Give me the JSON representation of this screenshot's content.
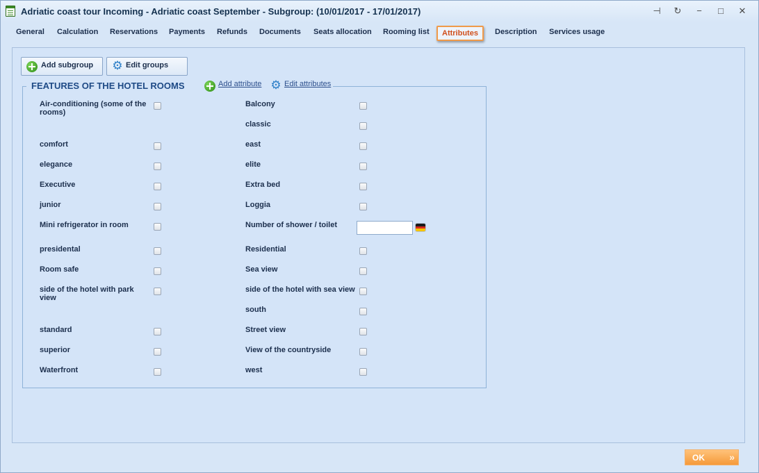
{
  "window": {
    "title": "Adriatic coast tour Incoming - Adriatic coast September - Subgroup: (10/01/2017 - 17/01/2017)",
    "controls": {
      "pin": "⊣",
      "refresh": "↻",
      "minimize": "−",
      "maximize": "□",
      "close": "✕"
    }
  },
  "tabs": [
    {
      "label": "General",
      "active": false
    },
    {
      "label": "Calculation",
      "active": false
    },
    {
      "label": "Reservations",
      "active": false
    },
    {
      "label": "Payments",
      "active": false
    },
    {
      "label": "Refunds",
      "active": false
    },
    {
      "label": "Documents",
      "active": false
    },
    {
      "label": "Seats allocation",
      "active": false
    },
    {
      "label": "Rooming list",
      "active": false
    },
    {
      "label": "Attributes",
      "active": true
    },
    {
      "label": "Description",
      "active": false
    },
    {
      "label": "Services usage",
      "active": false
    }
  ],
  "toolbar": {
    "add_subgroup": "Add subgroup",
    "edit_groups": "Edit groups"
  },
  "section": {
    "title": "FEATURES OF THE HOTEL ROOMS",
    "add_attribute": "Add attribute",
    "edit_attributes": "Edit attributes"
  },
  "attributes_left": [
    {
      "label": "Air-conditioning (some of the rooms)",
      "checked": false
    },
    {
      "label": "comfort",
      "checked": false
    },
    {
      "label": "elegance",
      "checked": false
    },
    {
      "label": "Executive",
      "checked": false
    },
    {
      "label": "junior",
      "checked": false
    },
    {
      "label": "Mini refrigerator in room",
      "checked": false
    },
    {
      "label": "presidental",
      "checked": false
    },
    {
      "label": "Room safe",
      "checked": false
    },
    {
      "label": "side of the hotel with park view",
      "checked": false
    },
    {
      "label": "standard",
      "checked": false
    },
    {
      "label": "superior",
      "checked": false
    },
    {
      "label": "Waterfront",
      "checked": false
    }
  ],
  "attributes_right": [
    {
      "label": "Balcony",
      "checked": false
    },
    {
      "label": "classic",
      "checked": false
    },
    {
      "label": "east",
      "checked": false
    },
    {
      "label": "elite",
      "checked": false
    },
    {
      "label": "Extra bed",
      "checked": false
    },
    {
      "label": "Loggia",
      "checked": false
    },
    {
      "label": "Number of shower / toilet",
      "type": "text",
      "value": ""
    },
    {
      "label": "Residential",
      "checked": false
    },
    {
      "label": "Sea view",
      "checked": false
    },
    {
      "label": "side of the hotel with sea view",
      "checked": false
    },
    {
      "label": "south",
      "checked": false
    },
    {
      "label": "Street view",
      "checked": false
    },
    {
      "label": "View of the countryside",
      "checked": false
    },
    {
      "label": "west",
      "checked": false
    }
  ],
  "footer": {
    "ok_label": "OK"
  },
  "colors": {
    "accent": "#f09a4a",
    "panel": "#d4e4f8",
    "window": "#d7e6f7"
  }
}
